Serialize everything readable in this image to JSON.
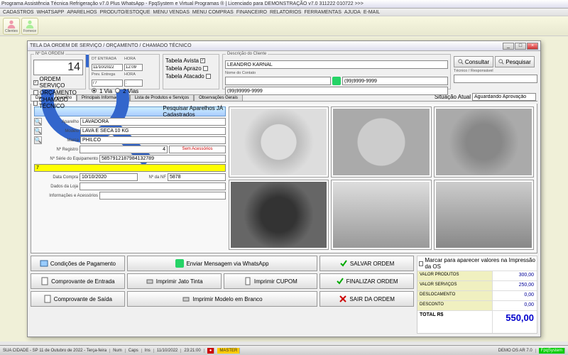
{
  "app_title": "Programa Assistência Técnica Refrigeração v7.0 Plus WhatsApp - FpqSystem e Virtual Programas ® | Licenciado para DEMONSTRAÇÃO v7.0 311222 010722 >>>",
  "menu": [
    "CADASTROS",
    "WHATSAPP",
    "APARELHOS",
    "PRODUTO/ESTOQUE",
    "MENU VENDAS",
    "MENU COMPRAS",
    "FINANCEIRO",
    "RELATORIOS",
    "FERRAMENTAS",
    "AJUDA",
    "E-MAIL"
  ],
  "toolbar": [
    {
      "lbl": "Clientes"
    },
    {
      "lbl": "Fornece"
    }
  ],
  "dialog": {
    "title": "TELA DA ORDEM DE SERVIÇO / ORÇAMENTO / CHAMADO TÉCNICO",
    "ordem": {
      "lbl": "Nº DA ORDEM",
      "num": "14",
      "opt1": "ORDEM SERVIÇO",
      "opt2": "ORÇAMENTO",
      "opt3": "CHAMADO TÉCNICO"
    },
    "dt": {
      "lbl1": "DT ENTRADA",
      "lbl2": "HORA",
      "d1": "11/10/2022",
      "h1": "12:09",
      "lbl3": "Prev. Entrega",
      "lbl4": "HORA",
      "d2": "/ /",
      "h2": ":",
      "via1": "1 Via",
      "via2": "2 Vias"
    },
    "tabela": {
      "t1": "Tabela Avista",
      "t2": "Tabela Aprazo",
      "t3": "Tabela Atacado"
    },
    "desc": {
      "lbl": "Descrição do Cliente",
      "nome": "LEANDRO KARNAL",
      "contato_lbl": "Nome do Contato",
      "fone1": "(99)9999-9999",
      "fone2": "(99)99999-9999"
    },
    "right": {
      "consultar": "Consultar",
      "pesquisar": "Pesquisar",
      "tec_lbl": "Técnico / Responsável"
    },
    "tabs": [
      "Dados do Aparelho",
      "Principais Informações",
      "Lista de Produtos e Serviços",
      "Observações Gerais"
    ],
    "situacao": {
      "lbl": "Situação Atual",
      "val": "Aguardando Aprovação"
    },
    "aparelho": {
      "search": "Pesquisar Aparelhos JÁ Cadastrados",
      "ap_lbl": "Aparelho",
      "ap": "LAVADORA",
      "mo_lbl": "Modelo",
      "mo": "LAVA E SECA 10 KG",
      "ma_lbl": "Marca",
      "ma": "PHILCO",
      "reg_lbl": "Nº Registro",
      "reg": "4",
      "sem": "Sem Acessórios",
      "serie_lbl": "Nº Série do Equipamento",
      "serie": "5857912187984132789",
      "serie_sel": "7",
      "dc_lbl": "Data Compra",
      "dc": "10/10/2020",
      "nf_lbl": "Nº da NF",
      "nf": "5878",
      "loja_lbl": "Dados da Loja",
      "info_lbl": "Informações e Acessórios"
    },
    "actions": {
      "cond": "Condições de Pagamento",
      "wa": "Enviar Mensagem via WhatsApp",
      "salvar": "SALVAR ORDEM",
      "entrada": "Comprovante de Entrada",
      "jato": "Imprimir Jato Tinta",
      "cupom": "Imprimir CUPOM",
      "finalizar": "FINALIZAR ORDEM",
      "saida": "Comprovante de Saída",
      "branco": "Imprimir Modelo em Branco",
      "sair": "SAIR DA ORDEM"
    },
    "totals": {
      "chk": "Marcar para aparecer valores na Impressão da OS",
      "prod_lbl": "VALOR PRODUTOS",
      "prod": "300,00",
      "serv_lbl": "VALOR SERVIÇOS",
      "serv": "250,00",
      "desl_lbl": "DESLOCAMENTO",
      "desl": "0,00",
      "desc_lbl": "DESCONTO",
      "desc": "0,00",
      "tot_lbl": "TOTAL R$",
      "tot": "550,00"
    }
  },
  "status": {
    "city": "SUA CIDADE - SP 11 de Outubro de 2022 - Terça-feira",
    "num": "Num",
    "caps": "Caps",
    "ins": "Ins",
    "date": "11/10/2022",
    "time": "23:21:00",
    "master": "MASTER",
    "demo": "DEMO OS AR 7.0",
    "fpq": "FpqSystem"
  }
}
